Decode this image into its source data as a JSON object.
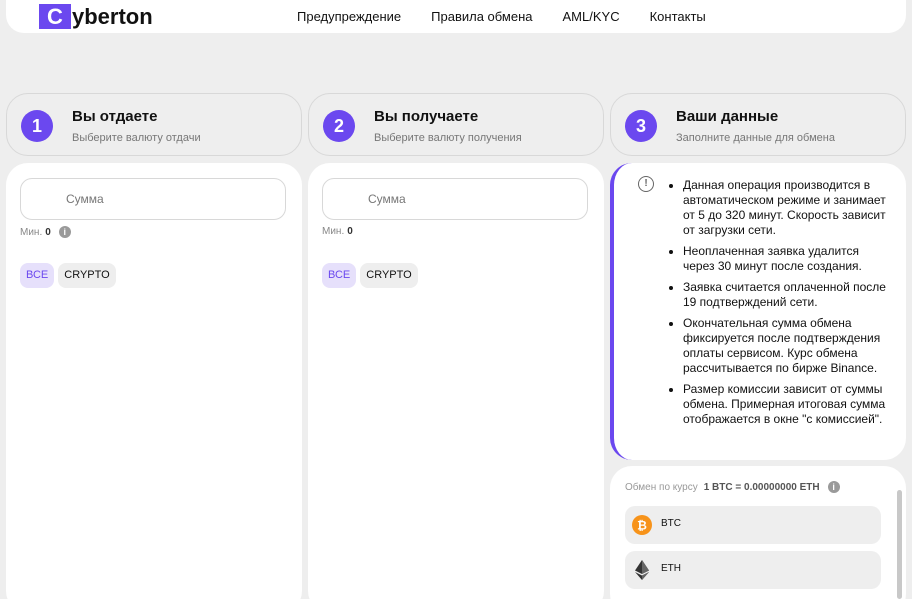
{
  "header": {
    "logo_letter": "C",
    "logo_rest": "yberton",
    "nav": [
      "Предупреждение",
      "Правила обмена",
      "AML/KYC",
      "Контакты"
    ]
  },
  "steps": [
    {
      "num": "1",
      "title": "Вы отдаете",
      "sub": "Выберите валюту отдачи"
    },
    {
      "num": "2",
      "title": "Вы получаете",
      "sub": "Выберите валюту получения"
    },
    {
      "num": "3",
      "title": "Ваши данные",
      "sub": "Заполните данные для обмена"
    }
  ],
  "give": {
    "placeholder": "Сумма",
    "min_label": "Мин.",
    "min_value": "0",
    "filter_all": "ВСЕ",
    "filter_crypto": "CRYPTO"
  },
  "receive": {
    "placeholder": "Сумма",
    "min_label": "Мин.",
    "min_value": "0",
    "filter_all": "ВСЕ",
    "filter_crypto": "CRYPTO"
  },
  "notice": {
    "items": [
      "Данная операция производится в автоматическом режиме и занимает от 5 до 320 минут. Скорость зависит от загрузки сети.",
      "Неоплаченная заявка удалится через 30 минут после создания.",
      "Заявка считается оплаченной после 19 подтверждений сети.",
      "Окончательная сумма обмена фиксируется после подтверждения оплаты сервисом. Курс обмена рассчитывается по бирже Binance.",
      "Размер комиссии зависит от суммы обмена. Примерная итоговая сумма отображается в окне \"с комиссией\"."
    ]
  },
  "rate": {
    "label": "Обмен по курсу",
    "value": "1 BTC = 0.00000000 ETH"
  },
  "coins": [
    {
      "name": "BTC",
      "icon": "bitcoin-icon",
      "color": "#f7931a"
    },
    {
      "name": "ETH",
      "icon": "ethereum-icon",
      "color": "#333333"
    }
  ],
  "colors": {
    "accent": "#6b48ef"
  }
}
